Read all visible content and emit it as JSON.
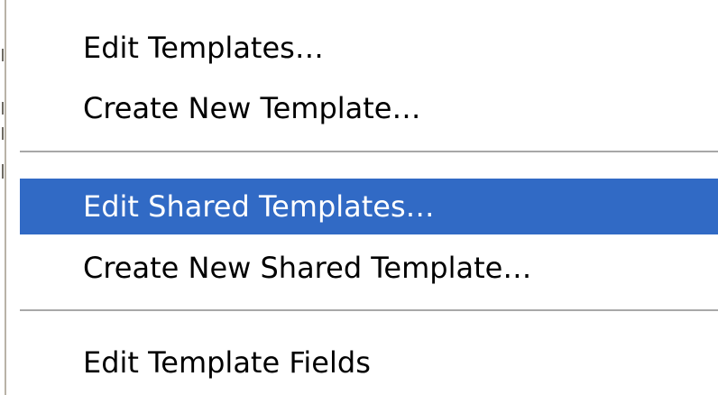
{
  "context_menu": {
    "items": [
      {
        "label": "Edit Templates…",
        "selected": false
      },
      {
        "label": "Create New Template…",
        "selected": false
      },
      {
        "label": "Edit Shared Templates…",
        "selected": true
      },
      {
        "label": "Create New Shared Template…",
        "selected": false
      },
      {
        "label": "Edit Template Fields",
        "selected": false
      }
    ]
  },
  "colors": {
    "selection_bg": "#316ac5",
    "selection_text": "#ffffff",
    "separator": "#a8a8a8",
    "frame_edge": "#b9b3a7"
  }
}
